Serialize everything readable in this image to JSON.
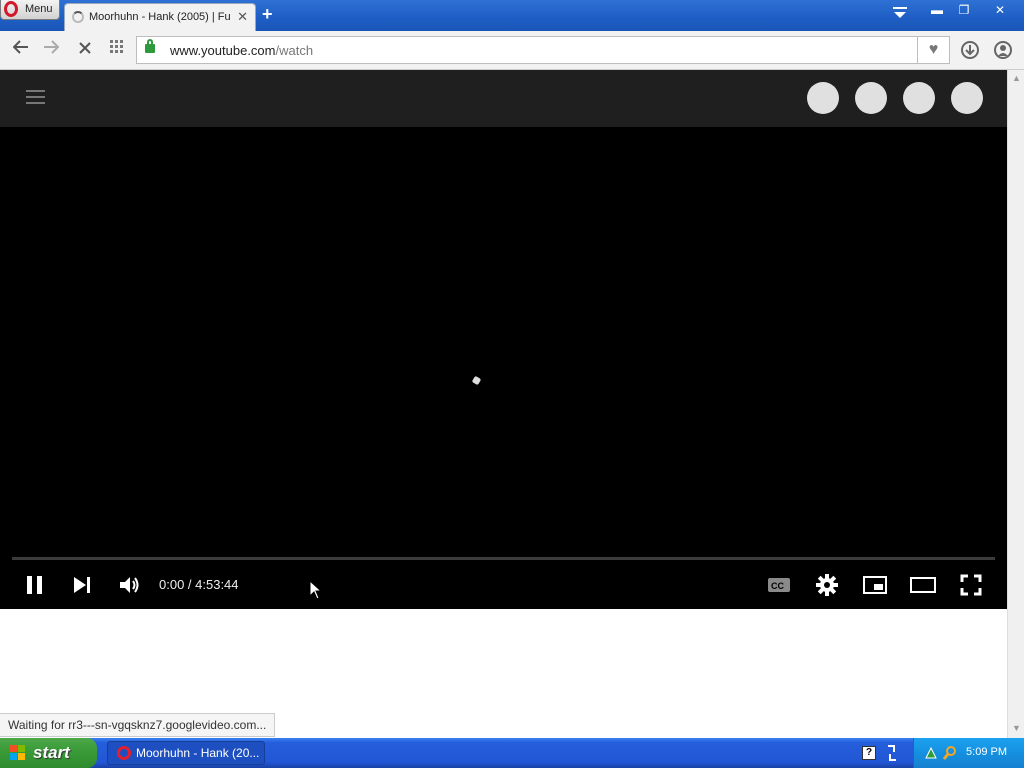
{
  "browser": {
    "menu_label": "Menu",
    "tab_title": "Moorhuhn - Hank (2005) | Fu",
    "tab_close": "✕",
    "new_tab": "+",
    "url_host": "www.youtube.com",
    "url_path": "/watch",
    "status_text": "Waiting for rr3---sn-vgqsknz7.googlevideo.com..."
  },
  "window_controls": {
    "minimize": "▬",
    "restore": "❐",
    "close": "✕"
  },
  "player": {
    "time_display": "0:00 / 4:53:44",
    "progress_fraction": 0,
    "state": "loading"
  },
  "taskbar": {
    "start_label": "start",
    "task_label": "Moorhuhn - Hank (20...",
    "clock": "5:09 PM"
  },
  "colors": {
    "titlebar": "#1e5ec4",
    "header": "#1f1f1f",
    "player": "#000000",
    "taskbar": "#245edb",
    "tray": "#1590e0"
  }
}
